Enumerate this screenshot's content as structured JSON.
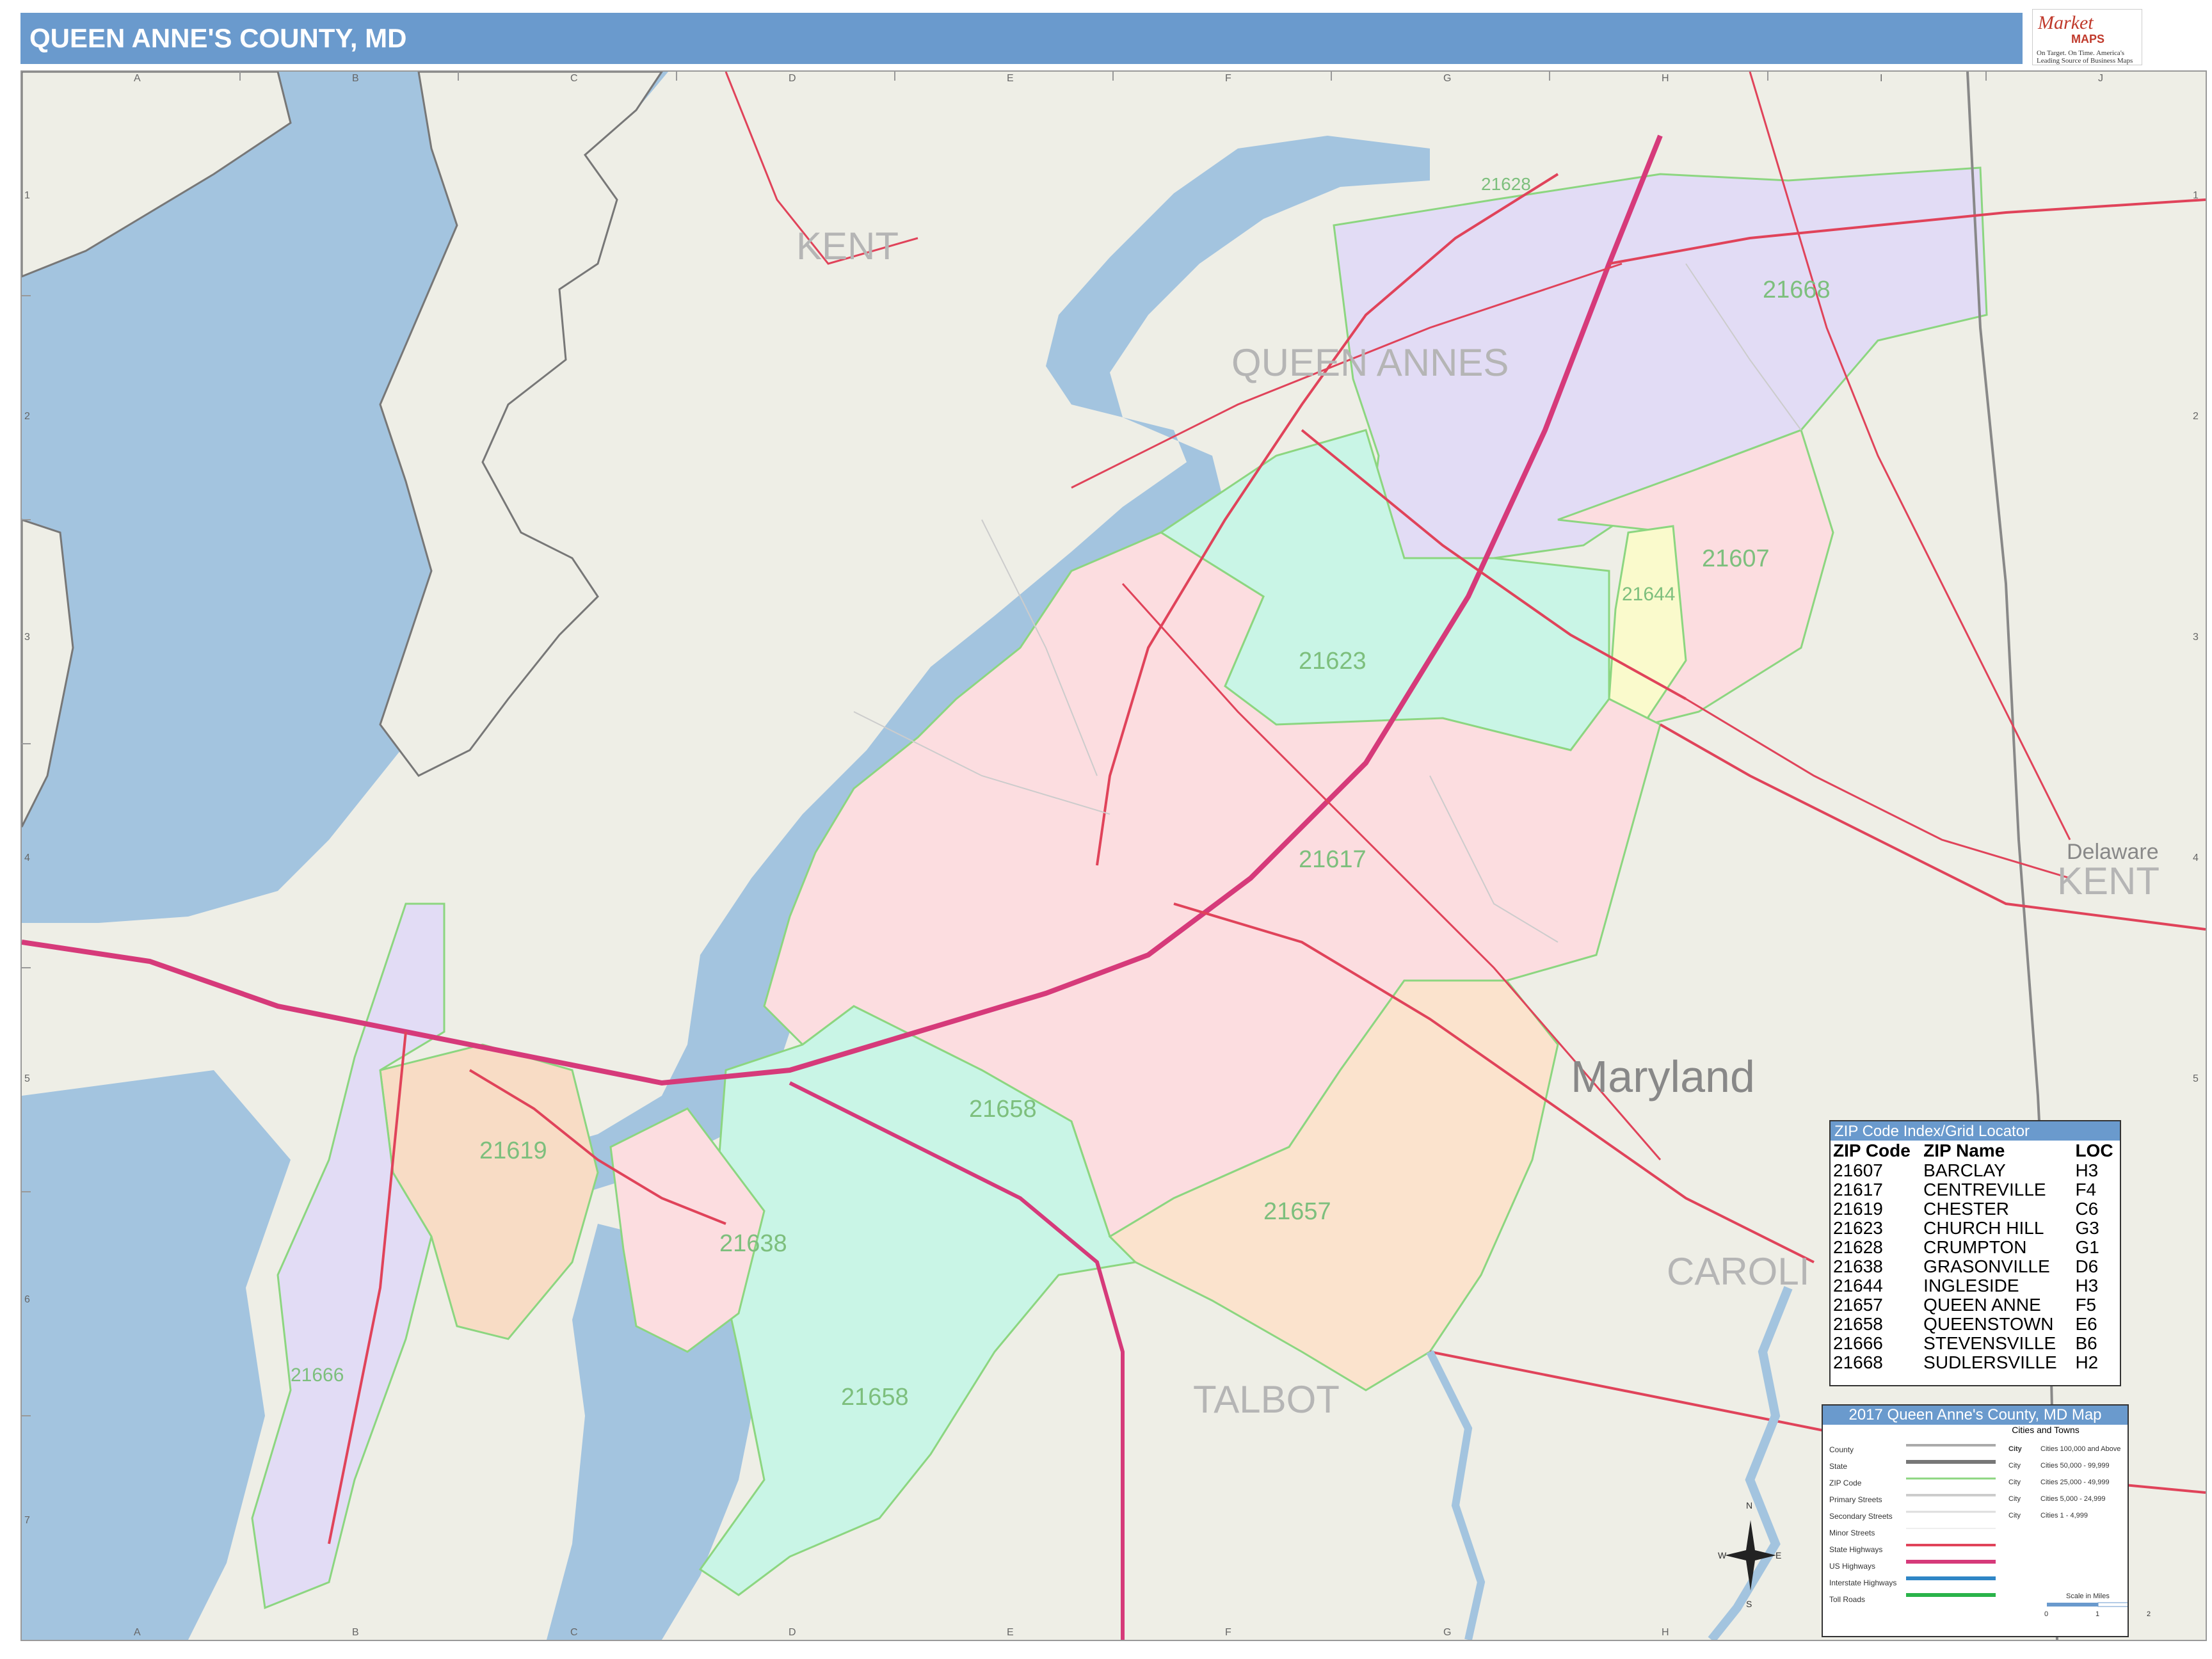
{
  "title": "QUEEN ANNE'S COUNTY, MD",
  "logo": {
    "line1": "Market",
    "line2": "MAPS",
    "line3": "On Target. On Time. America's Leading Source of Business Maps"
  },
  "grid": {
    "columns": [
      "A",
      "B",
      "C",
      "D",
      "E",
      "F",
      "G",
      "H",
      "I",
      "J"
    ],
    "rows": [
      "1",
      "2",
      "3",
      "4",
      "5",
      "6",
      "7"
    ]
  },
  "map": {
    "regions": {
      "kent": "KENT",
      "queen_annes": "QUEEN ANNES",
      "talbot": "TALBOT",
      "caroline": "CAROLI",
      "delaware": "Delaware",
      "delaware_kent": "KENT",
      "maryland": "Maryland"
    },
    "zip_labels": [
      "21668",
      "21607",
      "21644",
      "21623",
      "21617",
      "21658",
      "21619",
      "21638",
      "21657",
      "21666",
      "21658",
      "21628"
    ],
    "colors": {
      "water": "#a3c4df",
      "land": "#eeeee6",
      "zip_21668": "#e2dcf5",
      "zip_21617": "#fcdde0",
      "zip_21623": "#c9f5e6",
      "zip_21657": "#fbe3cd",
      "zip_21644": "#fafacc",
      "zip_21619": "#f8dcc5",
      "zip_21666": "#e2dcf5",
      "state_highway": "#e0435a",
      "us_highway": "#d63a7a",
      "zip_boundary": "#8cd680",
      "county_boundary": "#888888"
    }
  },
  "zip_index": {
    "title": "ZIP Code Index/Grid Locator",
    "headers": [
      "ZIP Code",
      "ZIP Name",
      "LOC"
    ],
    "rows": [
      [
        "21607",
        "BARCLAY",
        "H3"
      ],
      [
        "21617",
        "CENTREVILLE",
        "F4"
      ],
      [
        "21619",
        "CHESTER",
        "C6"
      ],
      [
        "21623",
        "CHURCH HILL",
        "G3"
      ],
      [
        "21628",
        "CRUMPTON",
        "G1"
      ],
      [
        "21638",
        "GRASONVILLE",
        "D6"
      ],
      [
        "21644",
        "INGLESIDE",
        "H3"
      ],
      [
        "21657",
        "QUEEN ANNE",
        "F5"
      ],
      [
        "21658",
        "QUEENSTOWN",
        "E6"
      ],
      [
        "21666",
        "STEVENSVILLE",
        "B6"
      ],
      [
        "21668",
        "SUDLERSVILLE",
        "H2"
      ]
    ]
  },
  "legend": {
    "title": "2017 Queen Anne's County, MD Map",
    "subtitle": "Cities and Towns",
    "items": [
      "County",
      "State",
      "ZIP Code",
      "Primary Streets",
      "Secondary Streets",
      "Minor Streets",
      "State Highways",
      "US Highways",
      "Interstate Highways",
      "Toll Roads"
    ],
    "cities": [
      [
        "City",
        "Cities 100,000 and Above"
      ],
      [
        "City",
        "Cities 50,000 - 99,999"
      ],
      [
        "City",
        "Cities 25,000 - 49,999"
      ],
      [
        "City",
        "Cities 5,000 - 24,999"
      ],
      [
        "City",
        "Cities 1 - 4,999"
      ]
    ],
    "scale_title": "Scale in Miles",
    "scale_ticks": [
      "0",
      "1",
      "2"
    ]
  },
  "compass": {
    "n": "N",
    "s": "S",
    "e": "E",
    "w": "W"
  }
}
